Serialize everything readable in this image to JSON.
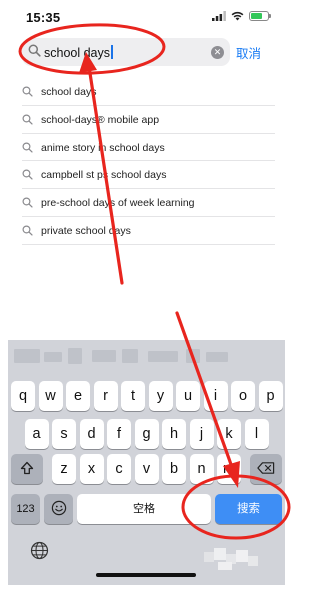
{
  "status": {
    "time": "15:35"
  },
  "search": {
    "query": "school days",
    "cancel_label": "取消"
  },
  "suggestions": [
    "school days",
    "school-days® mobile app",
    "anime story in school days",
    "campbell st ps school days",
    "pre-school days of week learning",
    "private school days"
  ],
  "keyboard": {
    "row1": [
      "q",
      "w",
      "e",
      "r",
      "t",
      "y",
      "u",
      "i",
      "o",
      "p"
    ],
    "row2": [
      "a",
      "s",
      "d",
      "f",
      "g",
      "h",
      "j",
      "k",
      "l"
    ],
    "row3": [
      "z",
      "x",
      "c",
      "v",
      "b",
      "n",
      "m"
    ],
    "numbers_label": "123",
    "space_label": "空格",
    "search_label": "搜索"
  },
  "colors": {
    "accent": "#1a7cf4",
    "annotation": "#e8251e",
    "search_key": "#3e8ef5"
  }
}
